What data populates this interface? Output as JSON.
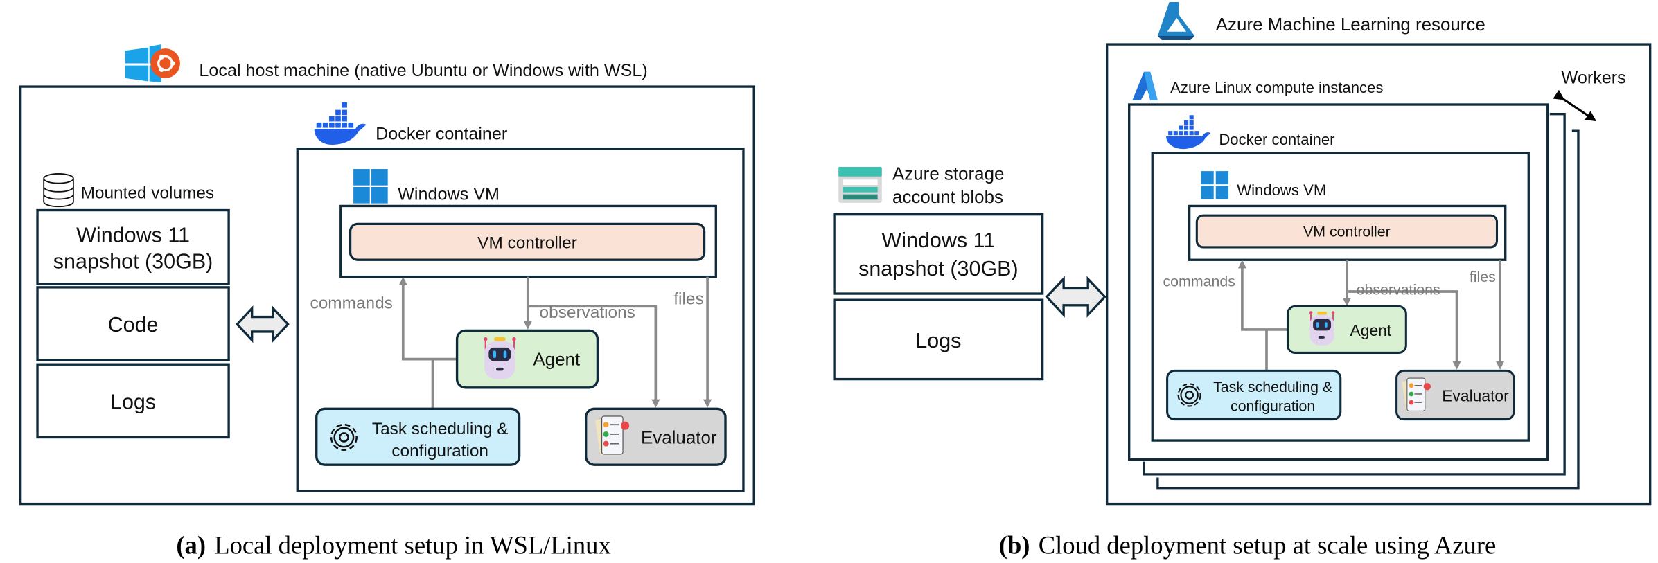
{
  "figure": {
    "panel_a": {
      "caption_tag": "(a)",
      "caption_text": "Local deployment setup in WSL/Linux",
      "host_label": "Local host machine (native Ubuntu or Windows with WSL)",
      "mounted_volumes_label": "Mounted volumes",
      "volumes": [
        {
          "line1": "Windows 11",
          "line2": "snapshot (30GB)"
        },
        {
          "line1": "Code",
          "line2": ""
        },
        {
          "line1": "Logs",
          "line2": ""
        }
      ],
      "docker_label": "Docker container",
      "windows_vm_label": "Windows VM",
      "vm_controller_label": "VM controller",
      "agent_label": "Agent",
      "task_label_line1": "Task scheduling &",
      "task_label_line2": "configuration",
      "evaluator_label": "Evaluator",
      "flow_labels": {
        "commands": "commands",
        "observations": "observations",
        "files": "files"
      }
    },
    "panel_b": {
      "caption_tag": "(b)",
      "caption_text": "Cloud deployment setup at scale using Azure",
      "storage_label_line1": "Azure storage",
      "storage_label_line2": "account blobs",
      "storage_items": [
        {
          "line1": "Windows 11",
          "line2": "snapshot (30GB)"
        },
        {
          "line1": "Logs",
          "line2": ""
        }
      ],
      "aml_label": "Azure Machine Learning resource",
      "compute_label": "Azure Linux compute instances",
      "workers_label": "Workers",
      "docker_label": "Docker container",
      "windows_vm_label": "Windows VM",
      "vm_controller_label": "VM controller",
      "agent_label": "Agent",
      "task_label_line1": "Task scheduling &",
      "task_label_line2": "configuration",
      "evaluator_label": "Evaluator",
      "flow_labels": {
        "commands": "commands",
        "observations": "observations",
        "files": "files"
      }
    },
    "colors": {
      "border": "#0f2a3a",
      "vm_controller_fill": "#fae3d6",
      "agent_fill": "#d9f0d2",
      "task_fill": "#cdeefb",
      "evaluator_fill": "#d6d6d6",
      "flow_arrow": "#8a8a8a",
      "docker_blue": "#2060e8",
      "windows_blue": "#1a8ad8",
      "ubuntu_orange": "#e95420",
      "azure_teal": "#3cc1b0"
    }
  }
}
